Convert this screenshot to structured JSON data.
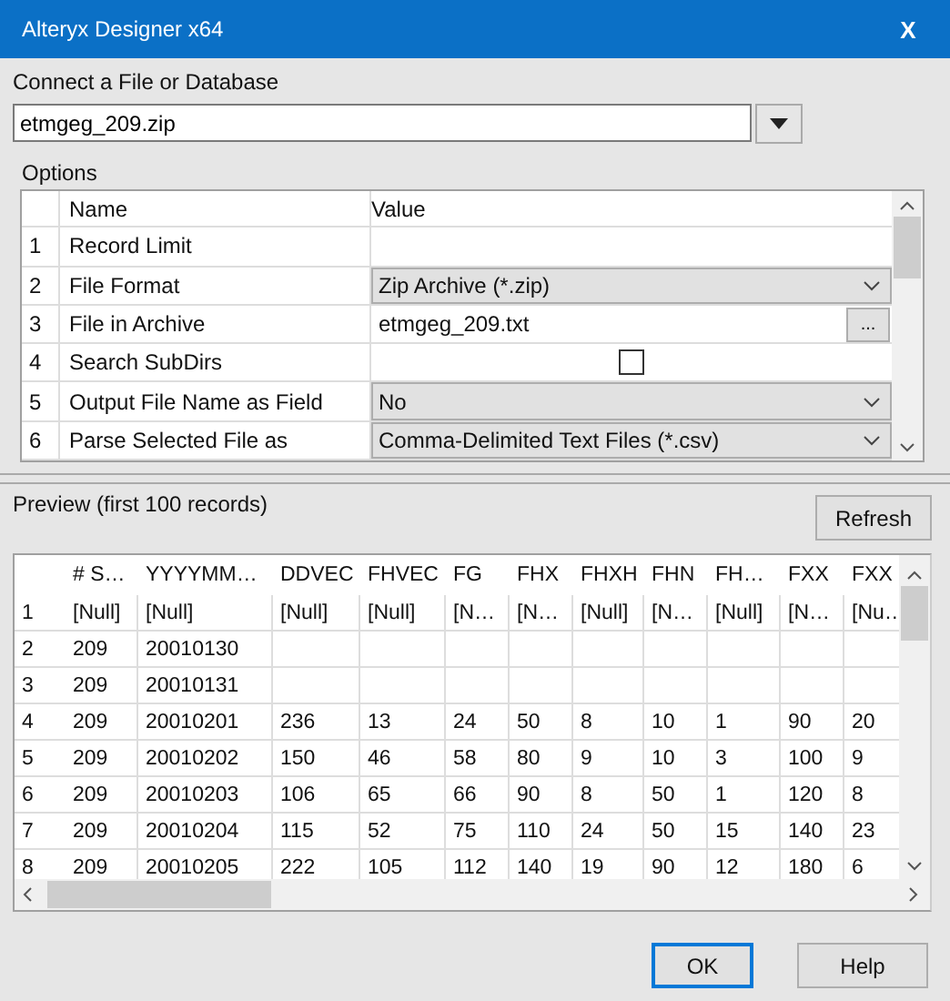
{
  "window": {
    "title": "Alteryx Designer x64",
    "close": "X"
  },
  "connect": {
    "label": "Connect a File or Database",
    "value": "etmgeg_209.zip"
  },
  "options": {
    "label": "Options",
    "columns": [
      "Name",
      "Value"
    ],
    "rows": [
      {
        "num": "1",
        "name": "Record Limit",
        "kind": "text",
        "value": ""
      },
      {
        "num": "2",
        "name": "File Format",
        "kind": "dropdown",
        "value": "Zip Archive (*.zip)"
      },
      {
        "num": "3",
        "name": "File in Archive",
        "kind": "browse",
        "value": "etmgeg_209.txt",
        "button": "..."
      },
      {
        "num": "4",
        "name": "Search SubDirs",
        "kind": "checkbox",
        "checked": false
      },
      {
        "num": "5",
        "name": "Output File Name as Field",
        "kind": "dropdown",
        "value": "No"
      },
      {
        "num": "6",
        "name": "Parse Selected File as",
        "kind": "dropdown",
        "value": "Comma-Delimited Text Files (*.csv)"
      }
    ]
  },
  "preview": {
    "label": "Preview (first 100 records)",
    "refresh": "Refresh",
    "columns": [
      "# S…",
      "YYYYMM…",
      "DDVEC",
      "FHVEC",
      "FG",
      "FHX",
      "FHXH",
      "FHN",
      "FH…",
      "FXX",
      "FXX"
    ],
    "rows": [
      {
        "num": "1",
        "cells": [
          "[Null]",
          "[Null]",
          "[Null]",
          "[Null]",
          "[N…",
          "[N…",
          "[Null]",
          "[N…",
          "[Null]",
          "[N…",
          "[Nu…"
        ]
      },
      {
        "num": "2",
        "cells": [
          "209",
          "20010130",
          "",
          "",
          "",
          "",
          "",
          "",
          "",
          "",
          ""
        ]
      },
      {
        "num": "3",
        "cells": [
          "209",
          "20010131",
          "",
          "",
          "",
          "",
          "",
          "",
          "",
          "",
          ""
        ]
      },
      {
        "num": "4",
        "cells": [
          "209",
          "20010201",
          "236",
          "13",
          "24",
          "50",
          "8",
          "10",
          "1",
          "90",
          "20"
        ]
      },
      {
        "num": "5",
        "cells": [
          "209",
          "20010202",
          "150",
          "46",
          "58",
          "80",
          "9",
          "10",
          "3",
          "100",
          "9"
        ]
      },
      {
        "num": "6",
        "cells": [
          "209",
          "20010203",
          "106",
          "65",
          "66",
          "90",
          "8",
          "50",
          "1",
          "120",
          "8"
        ]
      },
      {
        "num": "7",
        "cells": [
          "209",
          "20010204",
          "115",
          "52",
          "75",
          "110",
          "24",
          "50",
          "15",
          "140",
          "23"
        ]
      },
      {
        "num": "8",
        "cells": [
          "209",
          "20010205",
          "222",
          "105",
          "112",
          "140",
          "19",
          "90",
          "12",
          "180",
          "6"
        ]
      }
    ]
  },
  "buttons": [
    "OK",
    "Help"
  ]
}
